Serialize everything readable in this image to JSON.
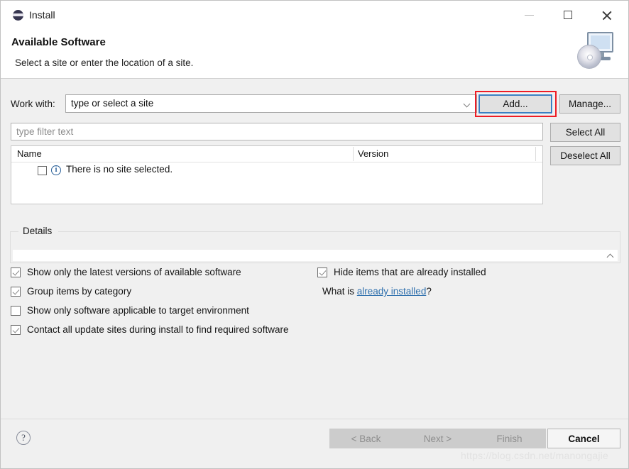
{
  "window": {
    "title": "Install",
    "icon": "eclipse-icon",
    "controls": {
      "minimize": "minimize-icon",
      "maximize": "maximize-icon",
      "close": "close-icon"
    }
  },
  "header": {
    "title": "Available Software",
    "subtitle": "Select a site or enter the location of a site.",
    "banner_icon": "monitor-disc-icon"
  },
  "work_with": {
    "label": "Work with:",
    "value": "type or select a site",
    "dropdown_icon": "chevron-down-icon"
  },
  "buttons": {
    "add": "Add...",
    "manage": "Manage...",
    "select_all": "Select All",
    "deselect_all": "Deselect All"
  },
  "filter": {
    "placeholder": "type filter text",
    "value": ""
  },
  "table": {
    "columns": [
      "Name",
      "Version"
    ],
    "rows": [
      {
        "checked": false,
        "icon": "info-icon",
        "name": "There is no site selected.",
        "version": ""
      }
    ]
  },
  "details": {
    "legend": "Details",
    "text": "",
    "expand_icon": "chevron-up-icon"
  },
  "options": {
    "left": [
      {
        "label": "Show only the latest versions of available software",
        "checked": true
      },
      {
        "label": "Group items by category",
        "checked": true
      },
      {
        "label": "Show only software applicable to target environment",
        "checked": false
      },
      {
        "label": "Contact all update sites during install to find required software",
        "checked": true
      }
    ],
    "right": [
      {
        "label": "Hide items that are already installed",
        "checked": true
      }
    ],
    "what_is_prefix": "What is ",
    "what_is_link": "already installed",
    "what_is_suffix": "?"
  },
  "footer": {
    "help": "?",
    "back": "< Back",
    "next": "Next >",
    "finish": "Finish",
    "cancel": "Cancel"
  },
  "watermark": "https://blog.csdn.net/manongajie",
  "colors": {
    "focus_border": "#3a7fc1",
    "annotation": "#ee1c25",
    "link": "#2e6fad",
    "info": "#2a6099",
    "window_bg": "#f0f0f0"
  }
}
